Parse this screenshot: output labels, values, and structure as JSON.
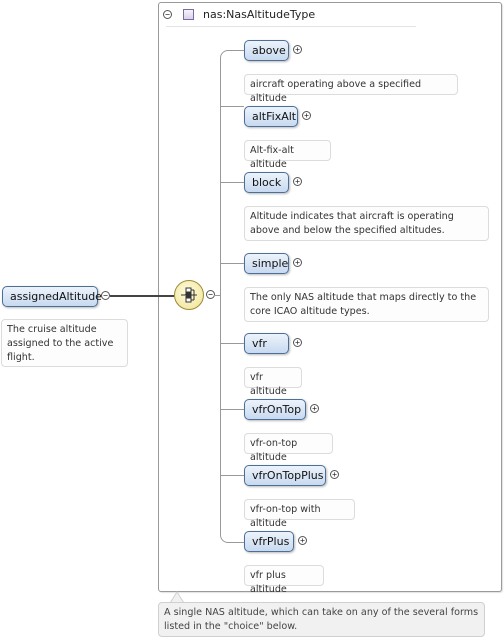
{
  "root": {
    "name": "assignedAltitude",
    "doc": "The cruise altitude assigned to the active flight."
  },
  "type": {
    "name": "nas:NasAltitudeType",
    "doc": "A single NAS altitude, which can take on any of the several forms listed in the \"choice\" below."
  },
  "compositor": {
    "kind": "choice",
    "icon": "choice-compositor-icon"
  },
  "toggles": {
    "collapse": "−",
    "expand": "+"
  },
  "children": [
    {
      "name": "above",
      "doc": "aircraft operating above a specified altitude"
    },
    {
      "name": "altFixAlt",
      "doc": "Alt-fix-alt altitude"
    },
    {
      "name": "block",
      "doc": "Altitude indicates that aircraft is operating above and below the specified altitudes."
    },
    {
      "name": "simple",
      "doc": "The only NAS altitude that maps directly to the core ICAO altitude types."
    },
    {
      "name": "vfr",
      "doc": "vfr altitude"
    },
    {
      "name": "vfrOnTop",
      "doc": "vfr-on-top altitude"
    },
    {
      "name": "vfrOnTopPlus",
      "doc": "vfr-on-top with altitude"
    },
    {
      "name": "vfrPlus",
      "doc": "vfr plus altitude"
    }
  ],
  "colors": {
    "element_fill": "#c8daf0",
    "element_border": "#4c6f98",
    "compositor_fill": "#efe28e"
  }
}
